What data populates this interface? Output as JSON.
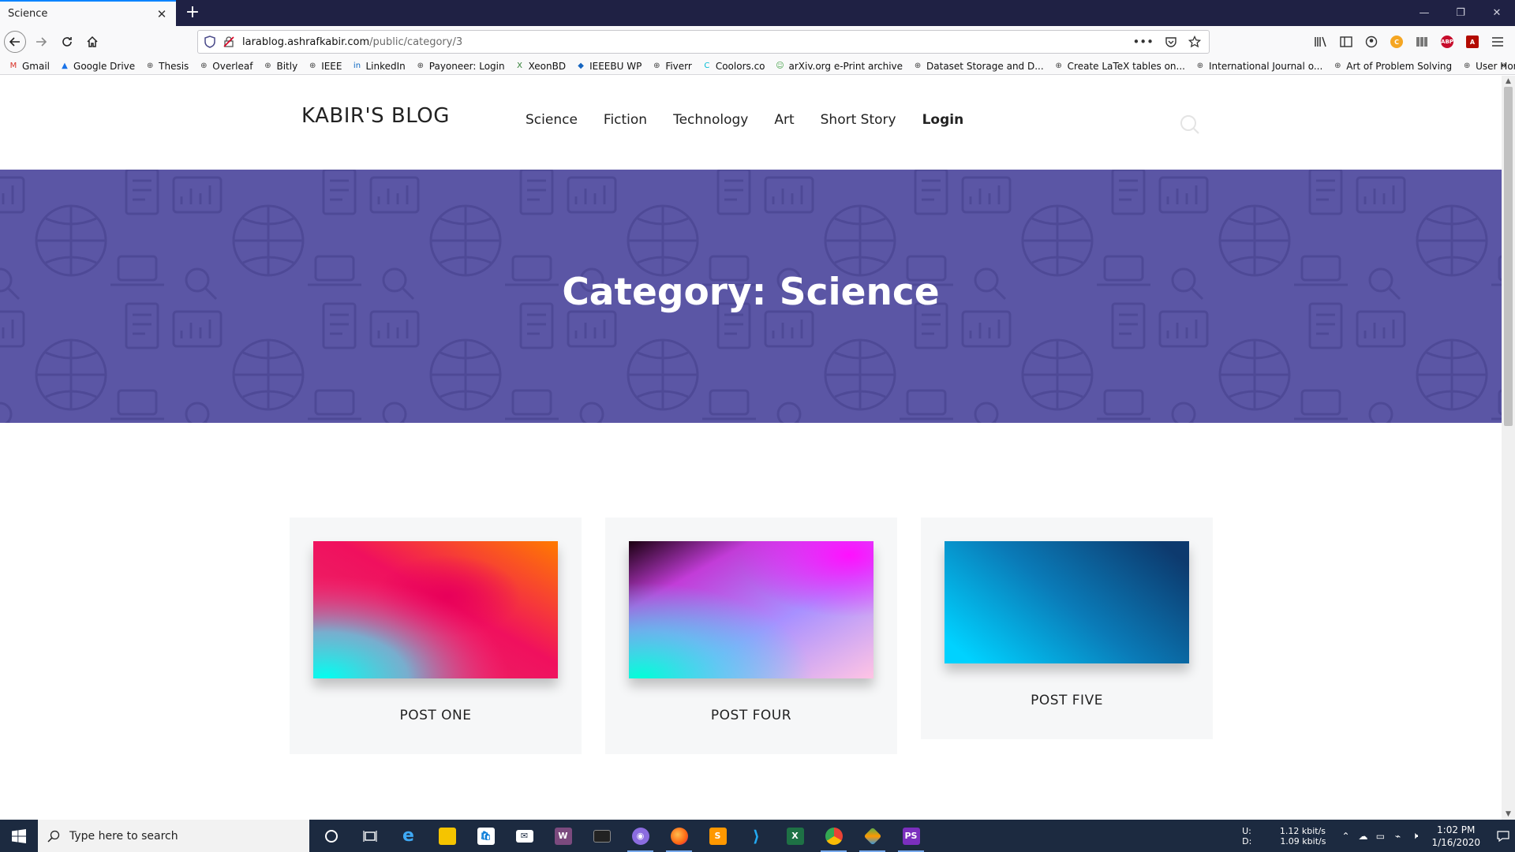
{
  "browser": {
    "tab_title": "Science",
    "tab_close": "✕",
    "new_tab": "+",
    "url_host": "larablog.ashrafkabir.com",
    "url_path": "/public/category/3",
    "url_prefix": "",
    "page_actions": "•••",
    "bookmarks": [
      {
        "label": "Gmail",
        "icon": "gmail-icon",
        "color": "#d93025",
        "glyph": "M"
      },
      {
        "label": "Google Drive",
        "icon": "drive-icon",
        "color": "#1a73e8",
        "glyph": "▲"
      },
      {
        "label": "Thesis",
        "icon": "globe-icon",
        "color": "#444",
        "glyph": "⊕"
      },
      {
        "label": "Overleaf",
        "icon": "globe-icon",
        "color": "#444",
        "glyph": "⊕"
      },
      {
        "label": "Bitly",
        "icon": "globe-icon",
        "color": "#444",
        "glyph": "⊕"
      },
      {
        "label": "IEEE",
        "icon": "globe-icon",
        "color": "#444",
        "glyph": "⊕"
      },
      {
        "label": "LinkedIn",
        "icon": "linkedin-icon",
        "color": "#0a66c2",
        "glyph": "in"
      },
      {
        "label": "Payoneer: Login",
        "icon": "globe-icon",
        "color": "#444",
        "glyph": "⊕"
      },
      {
        "label": "XeonBD",
        "icon": "xeonbd-icon",
        "color": "#2e7d32",
        "glyph": "X"
      },
      {
        "label": "IEEEBU WP",
        "icon": "ieeebu-icon",
        "color": "#1565c0",
        "glyph": "◆"
      },
      {
        "label": "Fiverr",
        "icon": "globe-icon",
        "color": "#444",
        "glyph": "⊕"
      },
      {
        "label": "Coolors.co",
        "icon": "coolors-icon",
        "color": "#00bcd4",
        "glyph": "C"
      },
      {
        "label": "arXiv.org e-Print archive",
        "icon": "arxiv-icon",
        "color": "#43a047",
        "glyph": "☺"
      },
      {
        "label": "Dataset Storage and D...",
        "icon": "globe-icon",
        "color": "#444",
        "glyph": "⊕"
      },
      {
        "label": "Create LaTeX tables on...",
        "icon": "globe-icon",
        "color": "#444",
        "glyph": "⊕"
      },
      {
        "label": "International Journal o...",
        "icon": "globe-icon",
        "color": "#444",
        "glyph": "⊕"
      },
      {
        "label": "Art of Problem Solving",
        "icon": "globe-icon",
        "color": "#444",
        "glyph": "⊕"
      },
      {
        "label": "User Home",
        "icon": "globe-icon",
        "color": "#444",
        "glyph": "⊕"
      }
    ],
    "bookmarks_overflow": "»",
    "window_controls": [
      "—",
      "❐",
      "✕"
    ]
  },
  "site": {
    "logo": "KABIR'S BLOG",
    "menu": [
      "Science",
      "Fiction",
      "Technology",
      "Art",
      "Short Story"
    ],
    "login": "Login",
    "hero_title": "Category: Science",
    "hero_color": "#5b56a5",
    "posts": [
      {
        "title": "POST ONE",
        "gradient": "pink-orange-cyan"
      },
      {
        "title": "POST FOUR",
        "gradient": "magenta-purple-cyan"
      },
      {
        "title": "POST FIVE",
        "gradient": "cyan-navy"
      }
    ]
  },
  "taskbar": {
    "search_placeholder": "Type here to search",
    "net_up_label": "U:",
    "net_up": "1.12 kbit/s",
    "net_down_label": "D:",
    "net_down": "1.09 kbit/s",
    "time": "1:02 PM",
    "date": "1/16/2020"
  }
}
